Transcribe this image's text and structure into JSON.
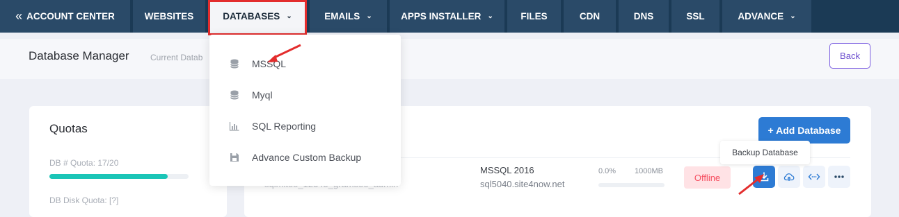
{
  "nav": {
    "tabs": [
      {
        "label": "ACCOUNT CENTER",
        "icon": "double-chevron-left-icon",
        "has_dropdown": false
      },
      {
        "label": "WEBSITES",
        "has_dropdown": false
      },
      {
        "label": "DATABASES",
        "has_dropdown": true,
        "active": true
      },
      {
        "label": "EMAILS",
        "has_dropdown": true
      },
      {
        "label": "APPS INSTALLER",
        "has_dropdown": true
      },
      {
        "label": "FILES",
        "has_dropdown": false
      },
      {
        "label": "CDN",
        "has_dropdown": false
      },
      {
        "label": "DNS",
        "has_dropdown": false
      },
      {
        "label": "SSL",
        "has_dropdown": false
      },
      {
        "label": "ADVANCE",
        "has_dropdown": true
      }
    ],
    "back_glyph": "«",
    "chevron_glyph": "⌄"
  },
  "dropdown": {
    "items": [
      {
        "label": "MSSQL",
        "icon": "database-icon"
      },
      {
        "label": "Myql",
        "icon": "database-icon"
      },
      {
        "label": "SQL Reporting",
        "icon": "bar-chart-icon"
      },
      {
        "label": "Advance Custom Backup",
        "icon": "save-icon"
      }
    ]
  },
  "subheader": {
    "title": "Database Manager",
    "crumb": "Current Datab",
    "back_label": "Back"
  },
  "quotas": {
    "title": "Quotas",
    "db_quota_label": "DB # Quota: 17/20",
    "db_quota_fraction": 0.85,
    "disk_quota_label": "DB Disk Quota: [?]"
  },
  "databases": {
    "add_label": "+ Add Database",
    "rows": [
      {
        "name": "sqlmitoo_12345_gramsoo_admin",
        "version": "MSSQL 2016",
        "server": "sql5040.site4now.net",
        "usage_pct": "0.0%",
        "usage_fraction": 0.0,
        "size": "1000MB",
        "status": "Offline"
      }
    ],
    "tooltip": "Backup Database"
  },
  "colors": {
    "nav_bg": "#1b3a55",
    "tab_bg": "#2a4a68",
    "accent_teal": "#1bc5b7",
    "primary_blue": "#2d7bd4",
    "danger": "#f64e60",
    "highlight_red": "#e32d2d",
    "back_purple": "#6c4fcf"
  }
}
